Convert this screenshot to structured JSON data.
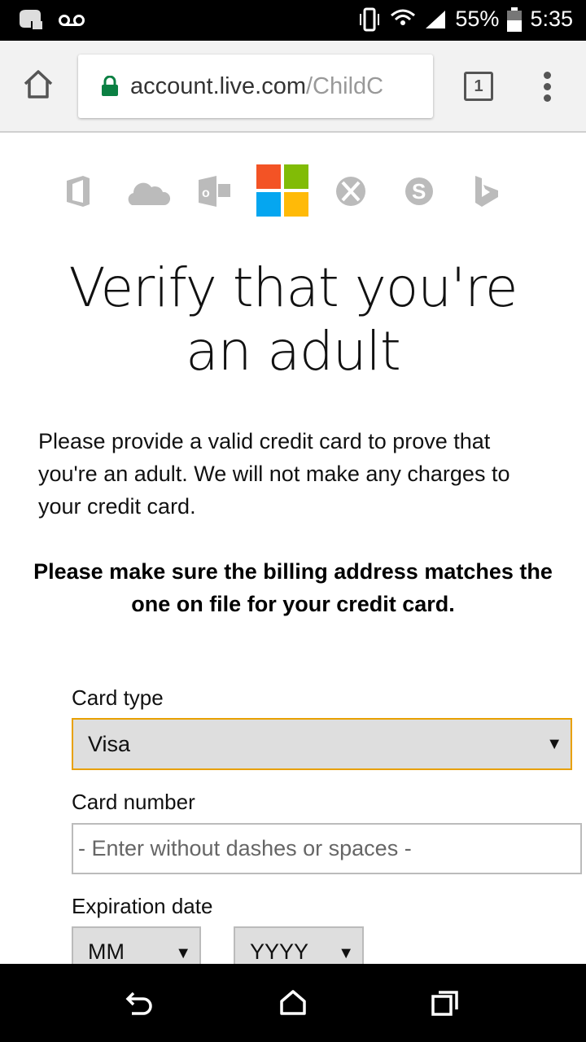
{
  "status_bar": {
    "battery": "55%",
    "time": "5:35"
  },
  "browser": {
    "url_host": "account.live.com",
    "url_path": "/ChildC",
    "tab_count": "1"
  },
  "brand_colors": {
    "red": "#f35325",
    "green": "#81bc06",
    "blue": "#05a6f0",
    "yellow": "#ffba08"
  },
  "product_icons": [
    "office-icon",
    "onedrive-icon",
    "outlook-icon",
    "microsoft-logo",
    "xbox-icon",
    "skype-icon",
    "bing-icon"
  ],
  "page": {
    "title": "Verify that you're an adult",
    "intro": "Please provide a valid credit card to prove that you're an adult. We will not make any charges to your credit card.",
    "note": "Please make sure the billing address matches the one on file for your credit card."
  },
  "form": {
    "card_type_label": "Card type",
    "card_type_value": "Visa",
    "card_number_label": "Card number",
    "card_number_placeholder": "- Enter without dashes or spaces -",
    "expiration_label": "Expiration date",
    "month_value": "MM",
    "year_value": "YYYY"
  }
}
